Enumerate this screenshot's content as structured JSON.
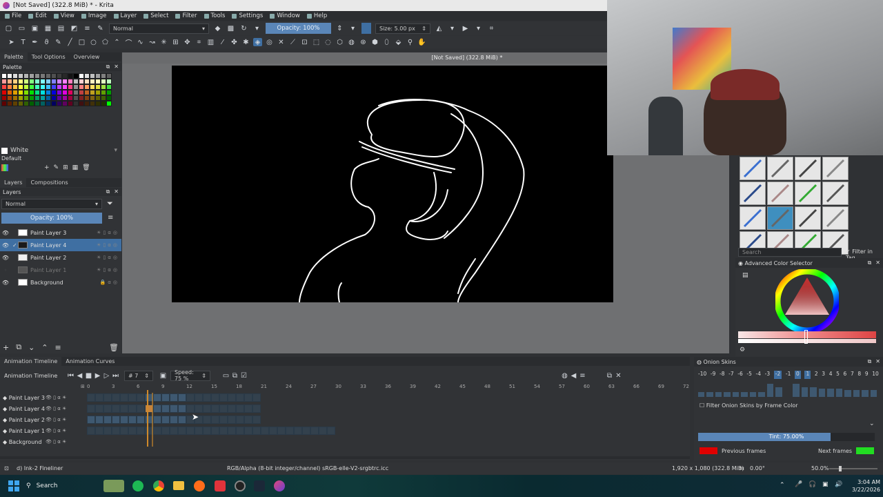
{
  "title_bar": {
    "text": "[Not Saved]  (322.8 MiB) * - Krita"
  },
  "menu": [
    {
      "label": "File"
    },
    {
      "label": "Edit"
    },
    {
      "label": "View"
    },
    {
      "label": "Image"
    },
    {
      "label": "Layer"
    },
    {
      "label": "Select"
    },
    {
      "label": "Filter"
    },
    {
      "label": "Tools"
    },
    {
      "label": "Settings"
    },
    {
      "label": "Window"
    },
    {
      "label": "Help"
    }
  ],
  "toolbar": {
    "blend_mode": "Normal",
    "opacity": "Opacity: 100%",
    "size": "Size: 5.00 px"
  },
  "left_dock": {
    "tabs": [
      "Palette",
      "Tool Options",
      "Overview"
    ],
    "palette_title": "Palette",
    "color_name": "White",
    "palette_set": "Default",
    "layers_tabs": [
      "Layers",
      "Compositions"
    ],
    "layers_title": "Layers",
    "blend_mode": "Normal",
    "opacity": "Opacity:  100%",
    "layers": [
      {
        "name": "Paint Layer 3"
      },
      {
        "name": "Paint Layer 4"
      },
      {
        "name": "Paint Layer 2"
      },
      {
        "name": "Paint Layer 1"
      },
      {
        "name": "Background"
      }
    ]
  },
  "canvas": {
    "info": "[Not Saved]  (322.8 MiB) *"
  },
  "right_panel": {
    "brush_search_placeholder": "Search",
    "filter_in_tag": "Filter in Tag",
    "color_selector_title": "Advanced Color Selector"
  },
  "animation": {
    "tabs": [
      "Animation Timeline",
      "Animation Curves"
    ],
    "title": "Animation Timeline",
    "frame": "7",
    "speed": "Speed: 75 %",
    "ruler": [
      "0",
      "3",
      "6",
      "9",
      "12",
      "15",
      "18",
      "21",
      "24",
      "27",
      "30",
      "33",
      "36",
      "39",
      "42",
      "45",
      "48",
      "51",
      "54",
      "57",
      "60",
      "63",
      "66",
      "69",
      "72"
    ],
    "layers": [
      {
        "name": "Paint Layer 3"
      },
      {
        "name": "Paint Layer 4"
      },
      {
        "name": "Paint Layer 2"
      },
      {
        "name": "Paint Layer 1"
      },
      {
        "name": "Background"
      }
    ]
  },
  "onion": {
    "title": "Onion Skins",
    "numbers": [
      "-10",
      "-9",
      "-8",
      "-7",
      "-6",
      "-5",
      "-4",
      "-3",
      "-2",
      "-1",
      "0",
      "1",
      "2",
      "3",
      "4",
      "5",
      "6",
      "7",
      "8",
      "9",
      "10"
    ],
    "filter_label": "Filter Onion Skins by Frame Color",
    "tint": "Tint: 75.00%",
    "tint_value": 0.75,
    "previous_frames": "Previous frames",
    "next_frames": "Next frames",
    "previous_color": "#e00000",
    "next_color": "#22dd22"
  },
  "status": {
    "brush": "d) Ink-2 Fineliner",
    "color_space": "RGB/Alpha (8-bit integer/channel)  sRGB-elle-V2-srgbtrc.icc",
    "dimensions": "1,920 x 1,080 (322.8 MiB)",
    "rotation": "0.00°",
    "zoom": "50.0%"
  },
  "taskbar": {
    "search": "Search",
    "time": "3:04 AM",
    "date": "3/22/2026"
  }
}
